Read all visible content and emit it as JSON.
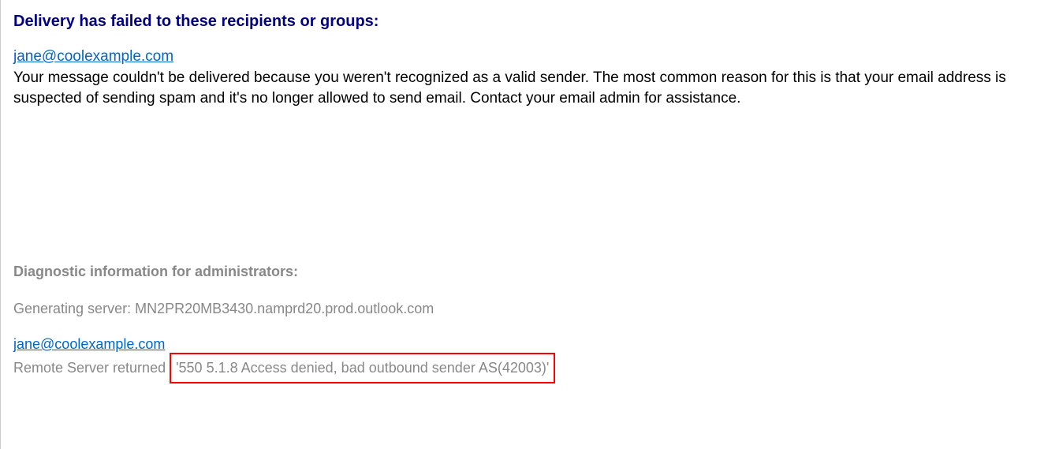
{
  "heading": "Delivery has failed to these recipients or groups:",
  "recipient": "jane@coolexample.com",
  "body": "Your message couldn't be delivered because you weren't recognized as a valid sender. The most common reason for this is that your email address is suspected of sending spam and it's no longer allowed to send email. Contact your email admin for assistance.",
  "diagnostic": {
    "heading": "Diagnostic information for administrators:",
    "server_label": "Generating server: ",
    "server_value": "MN2PR20MB3430.namprd20.prod.outlook.com",
    "recipient": "jane@coolexample.com",
    "remote_label": "Remote Server returned ",
    "remote_error": "'550 5.1.8 Access denied, bad outbound sender AS(42003)'"
  }
}
